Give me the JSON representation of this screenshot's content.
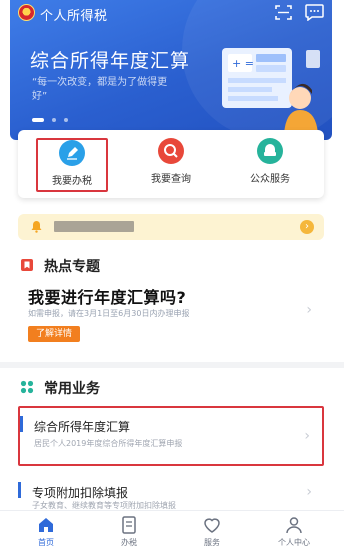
{
  "header": {
    "app_title": "个人所得税",
    "scan_icon": "scan-icon",
    "message_icon": "message-icon"
  },
  "banner": {
    "title": "综合所得年度汇算",
    "subtitle": "“每一次改变，都是为了做得更好”",
    "slide_count": 3,
    "active_slide": 1
  },
  "quick_actions": [
    {
      "label": "我要办税",
      "icon": "pen-icon",
      "color": "#2aa0e8",
      "highlighted": true
    },
    {
      "label": "我要查询",
      "icon": "search-icon",
      "color": "#e8483a",
      "highlighted": false
    },
    {
      "label": "公众服务",
      "icon": "service-icon",
      "color": "#26b39b",
      "highlighted": false
    }
  ],
  "notice": {
    "icon": "bell-icon"
  },
  "hot_topics": {
    "heading": "热点专题",
    "title": "我要进行年度汇算吗?",
    "description": "如需申报，请在3月1日至6月30日内办理申报",
    "button_label": "了解详情"
  },
  "common_business": {
    "heading": "常用业务",
    "items": [
      {
        "title": "综合所得年度汇算",
        "description": "居民个人2019年度综合所得年度汇算申报",
        "highlighted": true
      },
      {
        "title": "专项附加扣除填报",
        "description": "子女教育、继续教育等专项附加扣除填报",
        "highlighted": false
      }
    ]
  },
  "bottom_nav": [
    {
      "label": "首页",
      "icon": "home-icon",
      "active": true
    },
    {
      "label": "办税",
      "icon": "tax-icon",
      "active": false
    },
    {
      "label": "服务",
      "icon": "service-heart-icon",
      "active": false
    },
    {
      "label": "个人中心",
      "icon": "person-icon",
      "active": false
    }
  ],
  "colors": {
    "brand_blue": "#2f6ad9",
    "highlight_red": "#d9363e",
    "orange": "#f27f1f",
    "notice_bg": "#fdf3d2"
  }
}
